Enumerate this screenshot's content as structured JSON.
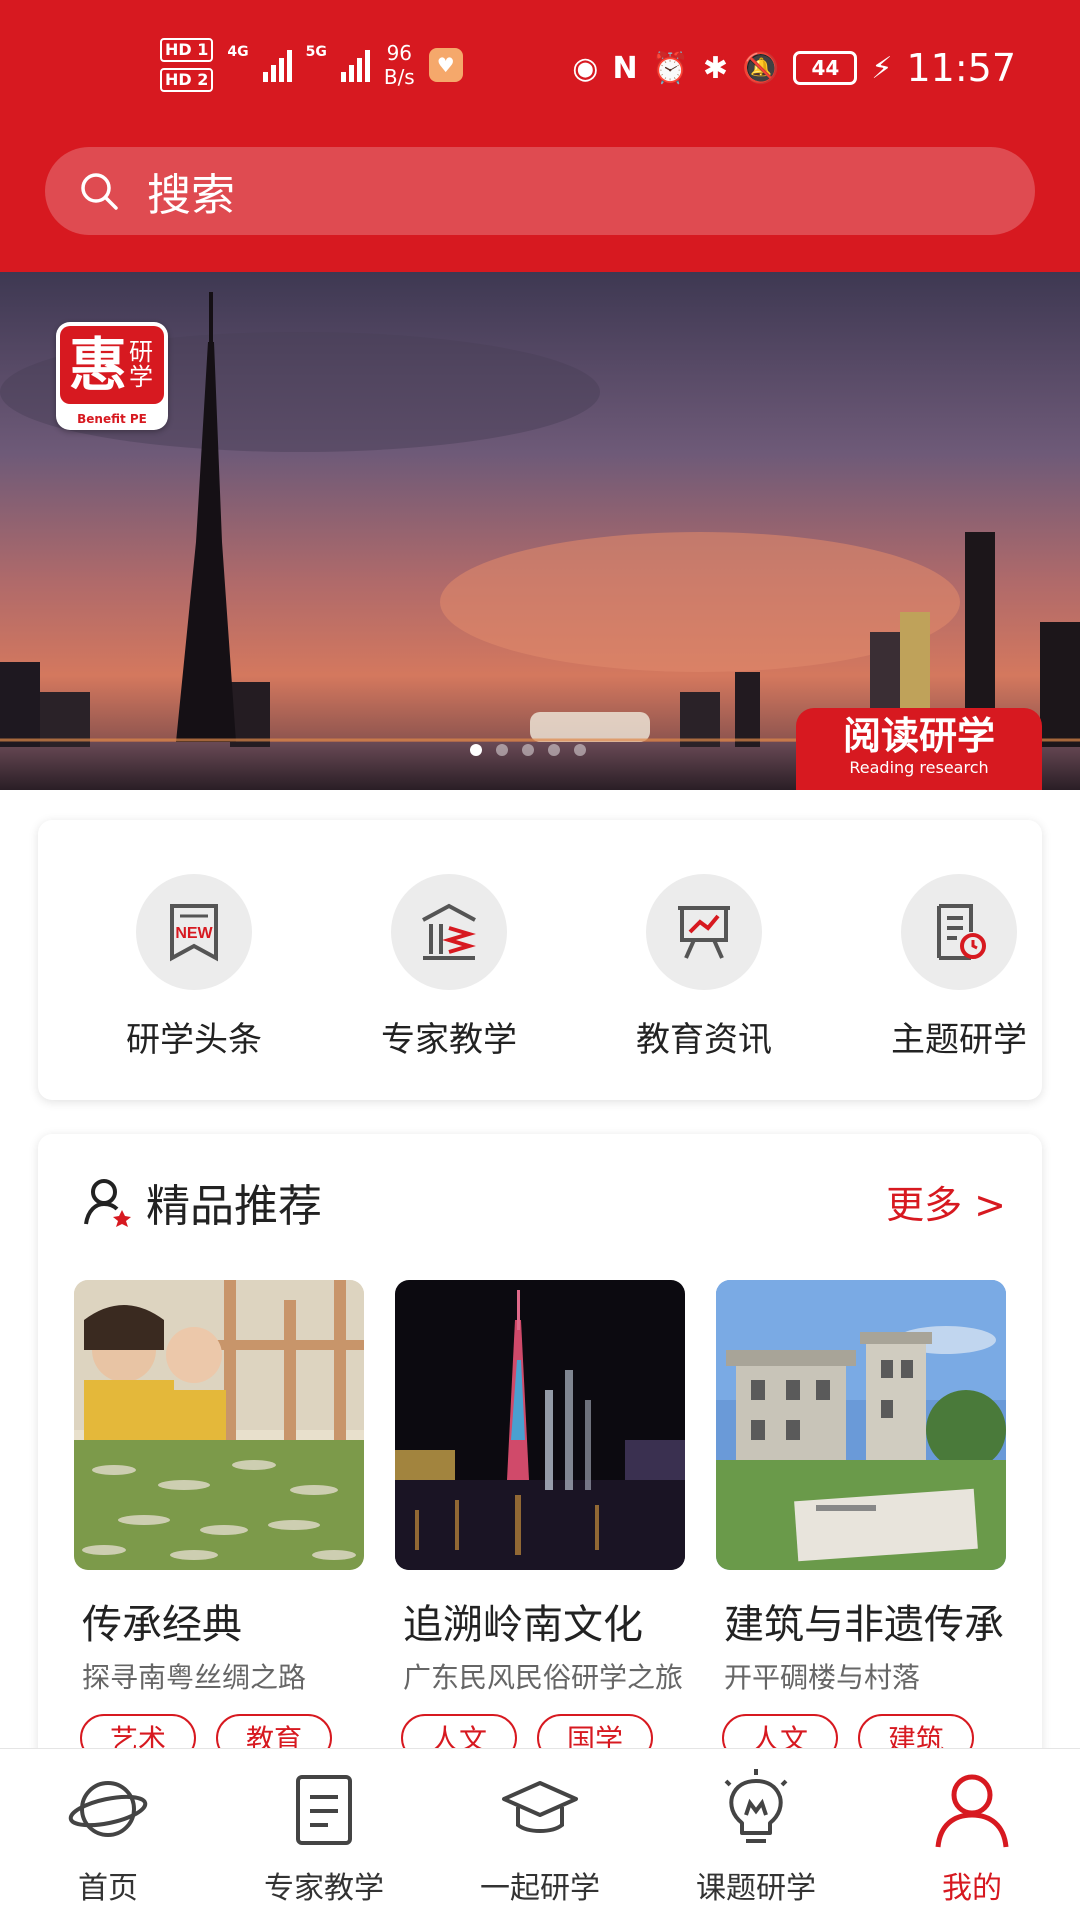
{
  "status_bar": {
    "sim1": "HD 1",
    "sim2": "HD 2",
    "net1": "4G",
    "net2": "5G",
    "speed_value": "96",
    "speed_unit": "B/s",
    "battery": "44",
    "time": "11:57"
  },
  "search": {
    "placeholder": "搜索"
  },
  "banner": {
    "logo_main": "惠",
    "logo_side": "研学",
    "logo_sub": "Benefit PE",
    "tag_title": "阅读研学",
    "tag_subtitle": "Reading research",
    "pager_count": 5,
    "pager_active": 0
  },
  "quick_nav": [
    {
      "label": "研学头条",
      "icon": "news-icon"
    },
    {
      "label": "专家教学",
      "icon": "expert-building-icon"
    },
    {
      "label": "教育资讯",
      "icon": "presentation-board-icon"
    },
    {
      "label": "主题研学",
      "icon": "document-clock-icon"
    }
  ],
  "recommend": {
    "title": "精品推荐",
    "more": "更多 >",
    "items": [
      {
        "title": "传承经典",
        "subtitle": "探寻南粤丝绸之路",
        "tags": [
          "艺术",
          "教育"
        ],
        "image": "silkworm-children-photo"
      },
      {
        "title": "追溯岭南文化",
        "subtitle": "广东民风民俗研学之旅",
        "tags": [
          "人文",
          "国学"
        ],
        "image": "canton-tower-night-photo"
      },
      {
        "title": "建筑与非遗传承",
        "subtitle": "开平碉楼与村落",
        "tags": [
          "人文",
          "建筑"
        ],
        "image": "kaiping-diaolou-photo"
      }
    ]
  },
  "bottom_nav": [
    {
      "label": "首页",
      "icon": "planet-icon",
      "active": false
    },
    {
      "label": "专家教学",
      "icon": "notebook-icon",
      "active": false
    },
    {
      "label": "一起研学",
      "icon": "graduation-cap-icon",
      "active": false
    },
    {
      "label": "课题研学",
      "icon": "lightbulb-icon",
      "active": false
    },
    {
      "label": "我的",
      "icon": "person-icon",
      "active": true
    }
  ],
  "colors": {
    "brand_red": "#d71920",
    "text": "#222222",
    "muted": "#666666"
  }
}
